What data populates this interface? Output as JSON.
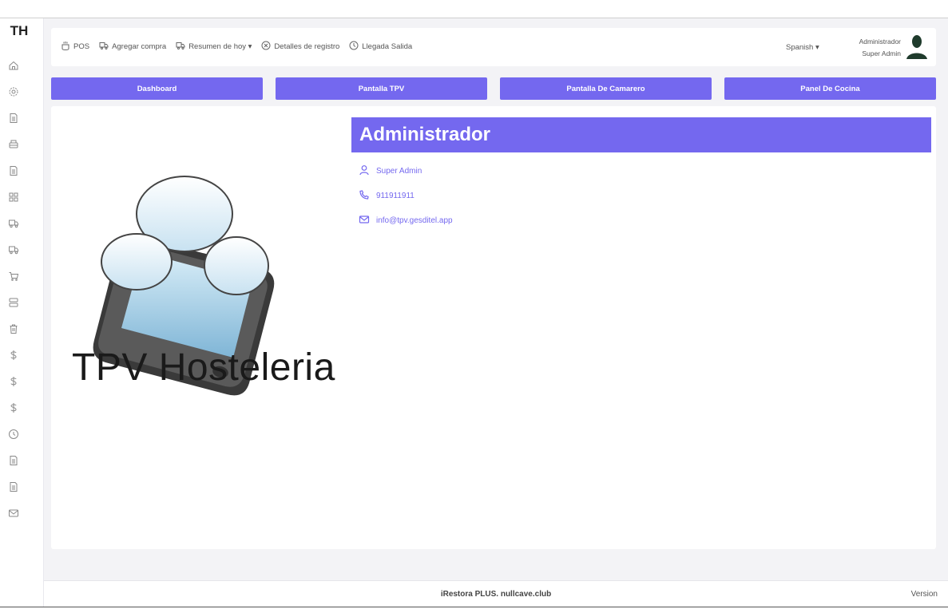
{
  "sidebar": {
    "brand": "TH",
    "icons": [
      "home-icon",
      "gear-icon",
      "document-icon",
      "printer-icon",
      "document-icon",
      "grid-icon",
      "truck-icon",
      "truck-icon",
      "cart-icon",
      "server-icon",
      "trash-icon",
      "dollar-icon",
      "dollar-icon",
      "dollar-icon",
      "clock-icon",
      "document-icon",
      "document-icon",
      "mail-icon"
    ]
  },
  "topbar": {
    "nav": [
      {
        "label": "POS",
        "icon": "pos-icon"
      },
      {
        "label": "Agregar compra",
        "icon": "truck-icon"
      },
      {
        "label": "Resumen de hoy ▾",
        "icon": "truck-icon"
      },
      {
        "label": "Detalles de registro",
        "icon": "close-circle-icon"
      },
      {
        "label": "Llegada Salida",
        "icon": "clock-icon"
      }
    ],
    "language": "Spanish ▾",
    "user_name": "Administrador",
    "user_role": "Super Admin"
  },
  "tabs": [
    "Dashboard",
    "Pantalla TPV",
    "Pantalla De Camarero",
    "Panel De Cocina"
  ],
  "logo": {
    "text": "TPV Hosteleria"
  },
  "profile": {
    "name": "Administrador",
    "role": "Super Admin",
    "phone": "911911911",
    "email": "info@tpv.gesditel.app"
  },
  "footer": {
    "text": "iRestora PLUS. nullcave.club",
    "version": "Version"
  },
  "colors": {
    "accent": "#7468ef",
    "background": "#f3f3f6"
  }
}
